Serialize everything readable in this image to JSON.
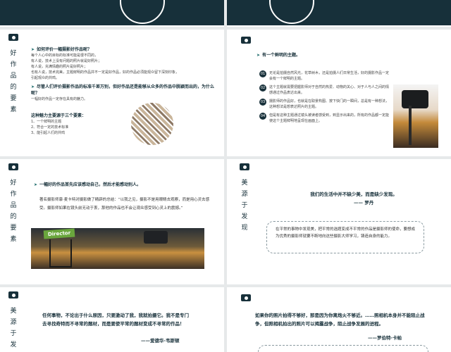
{
  "s1": {
    "side": "好作品的要素",
    "q_title": "如何评价一幅摄影好作品呢？",
    "lines": [
      "每个人心中的目标的标准可能是很不同的，",
      "有人说，技术上没有问题的照片就是好照片；",
      "有人说，充满情趣的照片是好照片；",
      "也有人说，技术完美，主题鲜明的作品并不一定是好作品，好的作品必须能观众留下深刻印象，",
      "引起观众的共鸣。"
    ],
    "q2": "尽管人们评价摄影作品的标准千差万别，但好作品还是能够从众多的作品中脱颖而出的，为什么呢？",
    "q2_sub": "一幅好的作品一定存在具有的魅力。",
    "ele_title": "这种魅力主要源于三个要素：",
    "elements": [
      "1、一个鲜明的主题",
      "2、符合一定的技术标准",
      "3、能引起人们的共鸣"
    ]
  },
  "s2": {
    "title": "有一个鲜明的主题。",
    "items": [
      {
        "n": "01",
        "text": "无论是拍摄自然风光，花草树木，还是拍摄人们日常生活，好的摄影作品一定会有一个鲜明的主题。"
      },
      {
        "n": "02",
        "text": "这个主题就需要把握影师对于自然的热爱、动物的关心、对于人与人之间的情感通过作品表达出来。"
      },
      {
        "n": "03",
        "text": "摄影师的作品好，也就是在取景构图、按下快门的一瞬间，总是有一种想法，这种想法是想表达照片的主题。"
      },
      {
        "n": "04",
        "text": "但是有这种主题通过镜头被读者感受到，到显示出来的，所有的作品都一定能使这个主题鲜明地呈现在画面上。"
      }
    ]
  },
  "s3": {
    "side": "好作品的要素",
    "lead": "一幅好的作品首先应该感动自己，然后才能感动别人。",
    "para": "著名摄影师康·麦卡特对摄影做了精辟的总结：“以我之见，摄影不是用眼睛去观察，而是用心灵去感受。摄影师如果在镜头前无动于衷，那他的作品也不会让观众感受到心灵上的震撼。”",
    "sign": "Director"
  },
  "s4": {
    "side": "美源于发现",
    "quote": "我们的生活中并不缺少美，而是缺少发现。",
    "author": "—— 罗丹",
    "box": "在平常的事物中发现美，把平常的选题变成不平常的作品是摄影师的使命，要想成为优秀的摄影师就要不断地向这些摄影大师学习，铸造自身的能力。"
  },
  "s5": {
    "side": "美源于发现",
    "quote": "任何事物，不论出于什么原因，只要激动了我，我就拍摄它。我不是专门去寻找奇特而不寻常的题材，而是要使平常的题材变成不寻常的作品！",
    "author": "——爱德华·韦斯顿"
  },
  "s6": {
    "quote": "如果你的照片拍得不够好，那是因为你离炮火不够近。……照相机本身并不能阻止战争，但照相机拍出的照片可以揭露战争，阻止战争发展的进程。",
    "author": "——罗伯特·卡帕"
  }
}
